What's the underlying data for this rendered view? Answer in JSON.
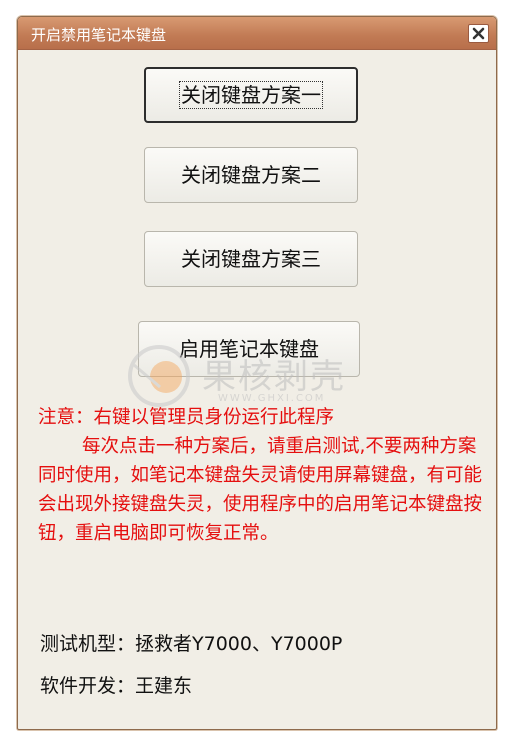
{
  "window": {
    "title": "开启禁用笔记本键盘"
  },
  "buttons": {
    "plan1": "关闭键盘方案一",
    "plan2": "关闭键盘方案二",
    "plan3": "关闭键盘方案三",
    "enable": "启用笔记本键盘"
  },
  "notice": {
    "heading": "注意：右键以管理员身份运行此程序",
    "body": "每次点击一种方案后，请重启测试,不要两种方案同时使用，如笔记本键盘失灵请使用屏幕键盘，有可能会出现外接键盘失灵，使用程序中的启用笔记本键盘按钮，重启电脑即可恢复正常。"
  },
  "info": {
    "tested_models": "测试机型：拯救者Y7000、Y7000P",
    "developer": "软件开发：王建东"
  },
  "watermark": {
    "text": "果核剥壳",
    "sub": "WWW.GHXI.COM"
  },
  "icons": {
    "close": "close-icon",
    "watermark_logo": "watermark-logo-icon"
  },
  "colors": {
    "titlebar": "#c17a54",
    "notice_text": "#e50f0f",
    "window_bg": "#f1eee6"
  }
}
